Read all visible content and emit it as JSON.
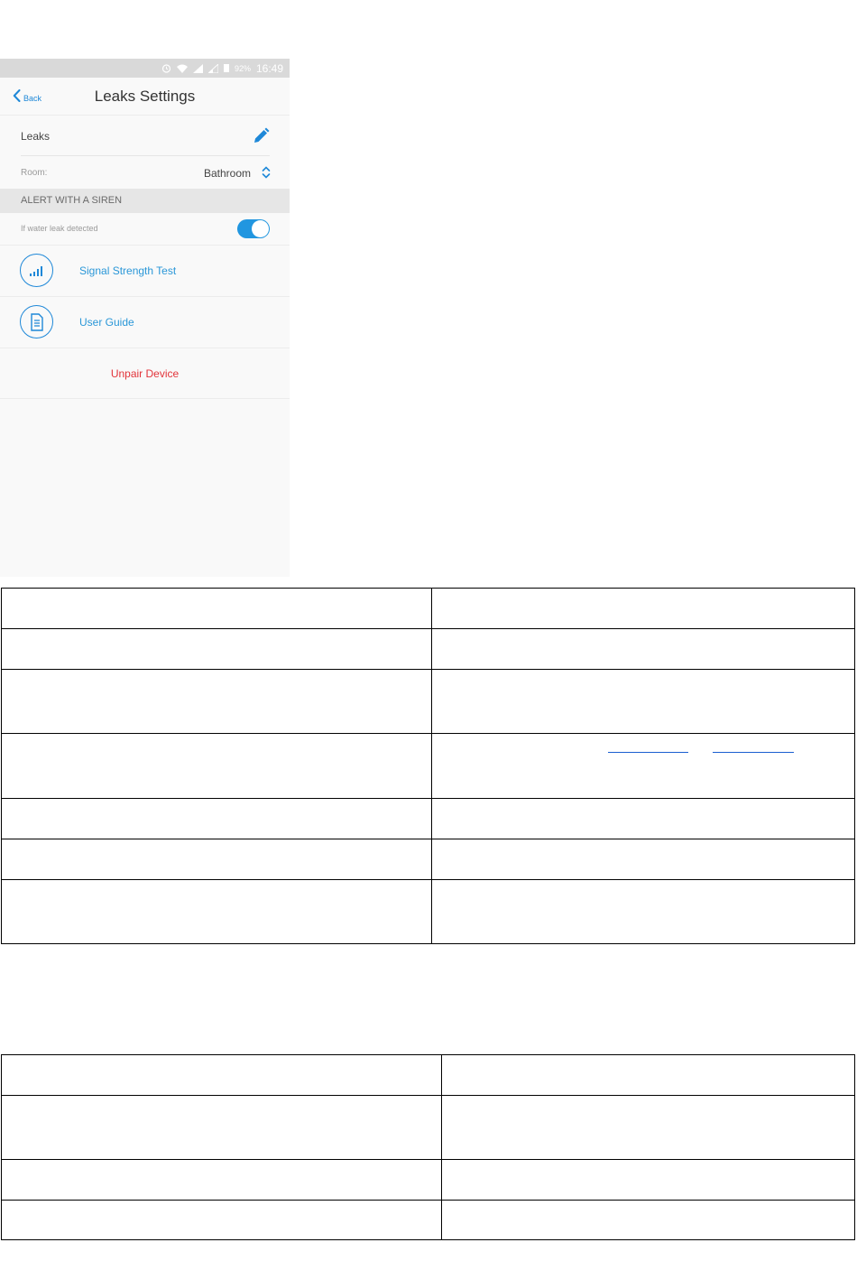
{
  "status_bar": {
    "icons": [
      "alarm-icon",
      "wifi-icon",
      "signal-icon",
      "signal-weak-icon",
      "battery-icon"
    ],
    "battery_percent": "92%",
    "time": "16:49"
  },
  "nav": {
    "back_label": "Back",
    "title": "Leaks Settings"
  },
  "device": {
    "name": "Leaks",
    "room_label": "Room:",
    "room_value": "Bathroom"
  },
  "siren_section": {
    "header": "ALERT WITH A SIREN",
    "toggle_label": "If water leak detected",
    "toggle_on": true
  },
  "actions": [
    {
      "label": "Signal Strength Test",
      "icon": "signal-bars-icon"
    },
    {
      "label": "User Guide",
      "icon": "document-icon"
    }
  ],
  "unpair_label": "Unpair Device",
  "colors": {
    "accent": "#1e88d8",
    "danger": "#e2343a",
    "section_bg": "#e6e6e6",
    "status_bg": "#d9d9d9"
  },
  "table1": {
    "rows": [
      [
        "",
        ""
      ],
      [
        "",
        ""
      ],
      [
        "",
        ""
      ],
      [
        "",
        ""
      ],
      [
        "",
        ""
      ],
      [
        "",
        ""
      ],
      [
        "",
        ""
      ]
    ]
  },
  "table2": {
    "rows": [
      [
        "",
        ""
      ],
      [
        "",
        ""
      ],
      [
        "",
        ""
      ],
      [
        "",
        ""
      ]
    ]
  }
}
